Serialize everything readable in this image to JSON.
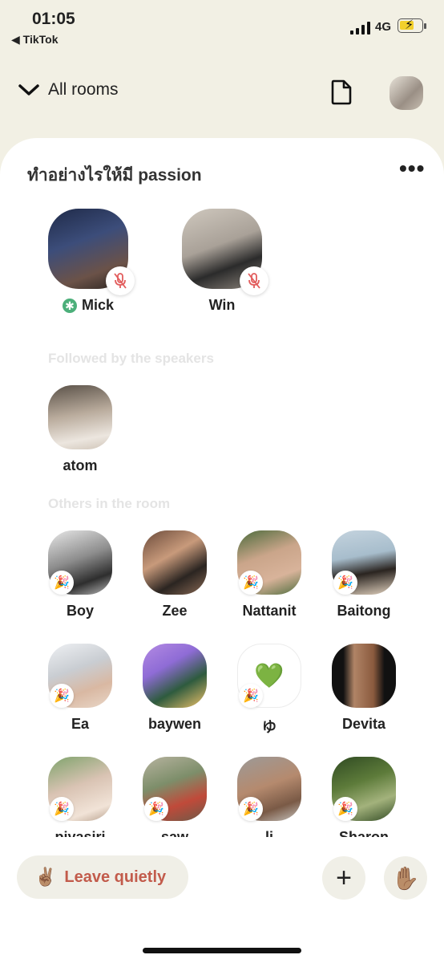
{
  "status_bar": {
    "time": "01:05",
    "back_app": "◀ TikTok",
    "network": "4G",
    "battery_level": 0.55,
    "battery_color": "#f2d02b"
  },
  "header": {
    "all_rooms_label": "All rooms",
    "chevron_icon": "chevron-down-icon",
    "doc_icon": "document-icon"
  },
  "room": {
    "title": "ทำอย่างไรให้มี passion",
    "more_label": "•••",
    "speakers": [
      {
        "name": "Mick",
        "moderator": true,
        "muted": true
      },
      {
        "name": "Win",
        "moderator": false,
        "muted": true
      }
    ],
    "followed_section": "Followed by the speakers",
    "followed": [
      {
        "name": "atom"
      }
    ],
    "others_section": "Others in the room",
    "others": [
      {
        "name": "Boy"
      },
      {
        "name": "Zee"
      },
      {
        "name": "Nattanit"
      },
      {
        "name": "Baitong"
      },
      {
        "name": "Ea"
      },
      {
        "name": "baywen"
      },
      {
        "name": "ゆ",
        "emoji": "💚"
      },
      {
        "name": "Devita"
      },
      {
        "name": "piyasiri"
      },
      {
        "name": "saw"
      },
      {
        "name": "li"
      },
      {
        "name": "Sharon"
      }
    ]
  },
  "bottom_bar": {
    "leave_emoji": "✌🏽",
    "leave_label": "Leave quietly",
    "plus_label": "+",
    "hand_emoji": "✋🏽"
  },
  "colors": {
    "background": "#f2f0e4",
    "leave_text": "#c25b4b",
    "moderator_badge": "#4caf7a"
  }
}
